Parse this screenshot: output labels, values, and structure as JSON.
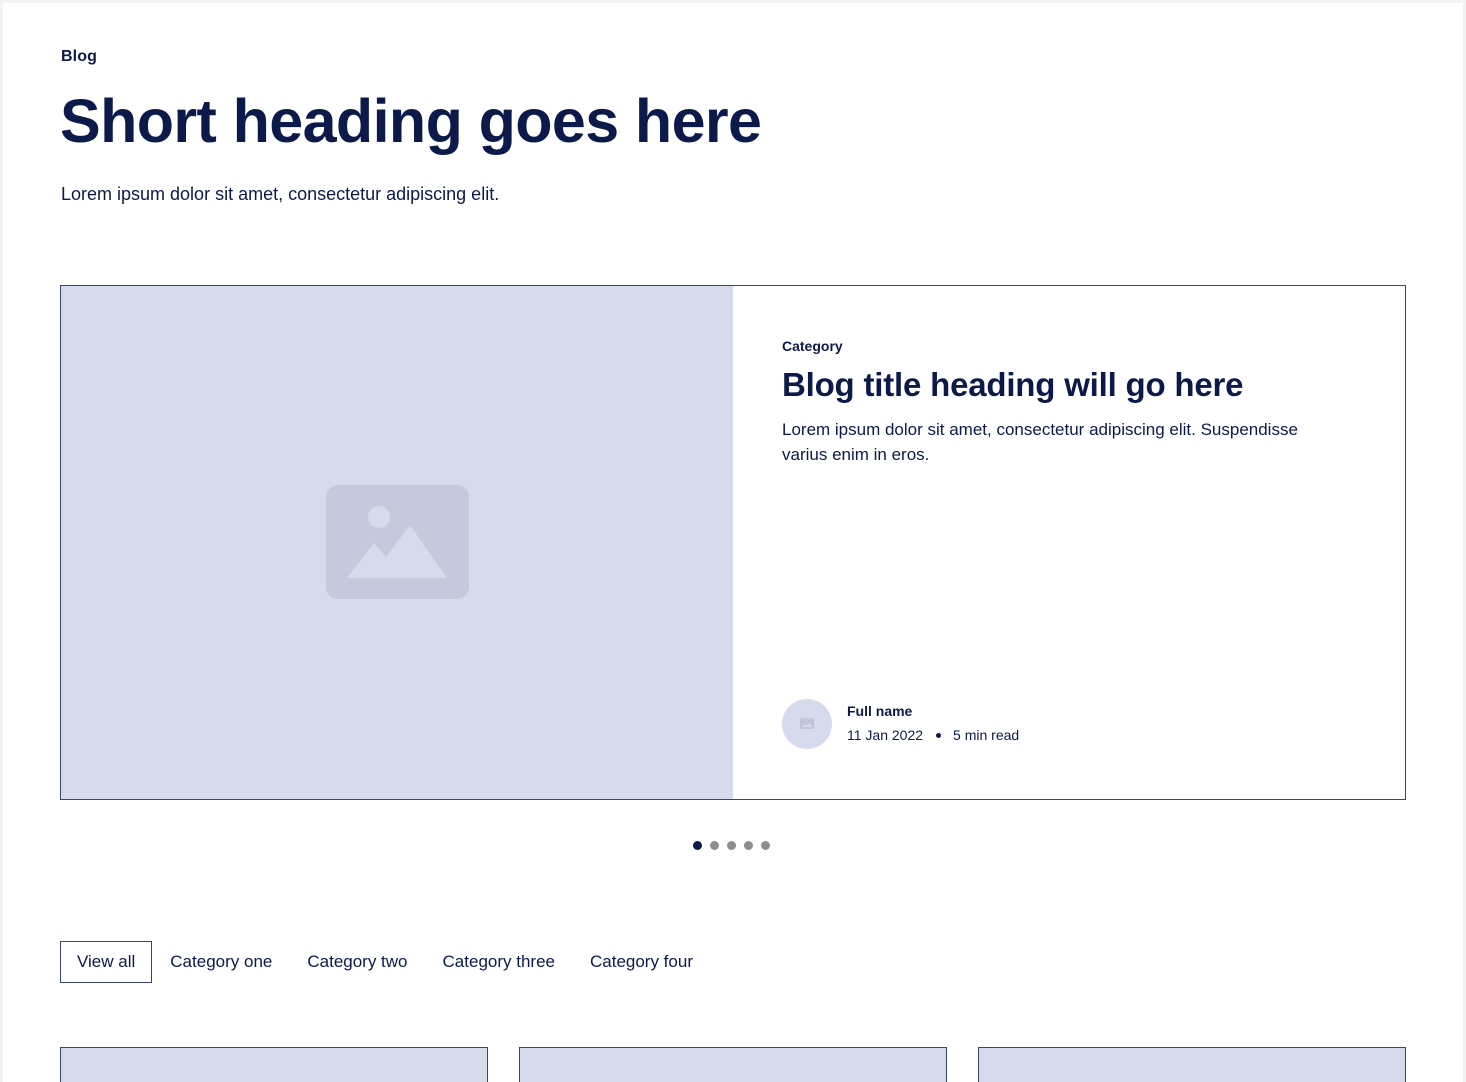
{
  "header": {
    "eyebrow": "Blog",
    "title": "Short heading goes here",
    "subtitle": "Lorem ipsum dolor sit amet, consectetur adipiscing elit."
  },
  "featured": {
    "image_icon": "image-placeholder-icon",
    "category": "Category",
    "title": "Blog title heading will go here",
    "description": "Lorem ipsum dolor sit amet, consectetur adipiscing elit. Suspendisse varius enim in eros.",
    "author": {
      "name": "Full name",
      "date": "11 Jan 2022",
      "read_time": "5 min read"
    }
  },
  "carousel": {
    "count": 5,
    "active_index": 0
  },
  "tabs": [
    {
      "label": "View all",
      "active": true
    },
    {
      "label": "Category one",
      "active": false
    },
    {
      "label": "Category two",
      "active": false
    },
    {
      "label": "Category three",
      "active": false
    },
    {
      "label": "Category four",
      "active": false
    }
  ],
  "colors": {
    "text": "#0c1a4a",
    "placeholder": "#d5dbec",
    "border": "#3b4670",
    "dot_inactive": "#8e8e8e"
  }
}
